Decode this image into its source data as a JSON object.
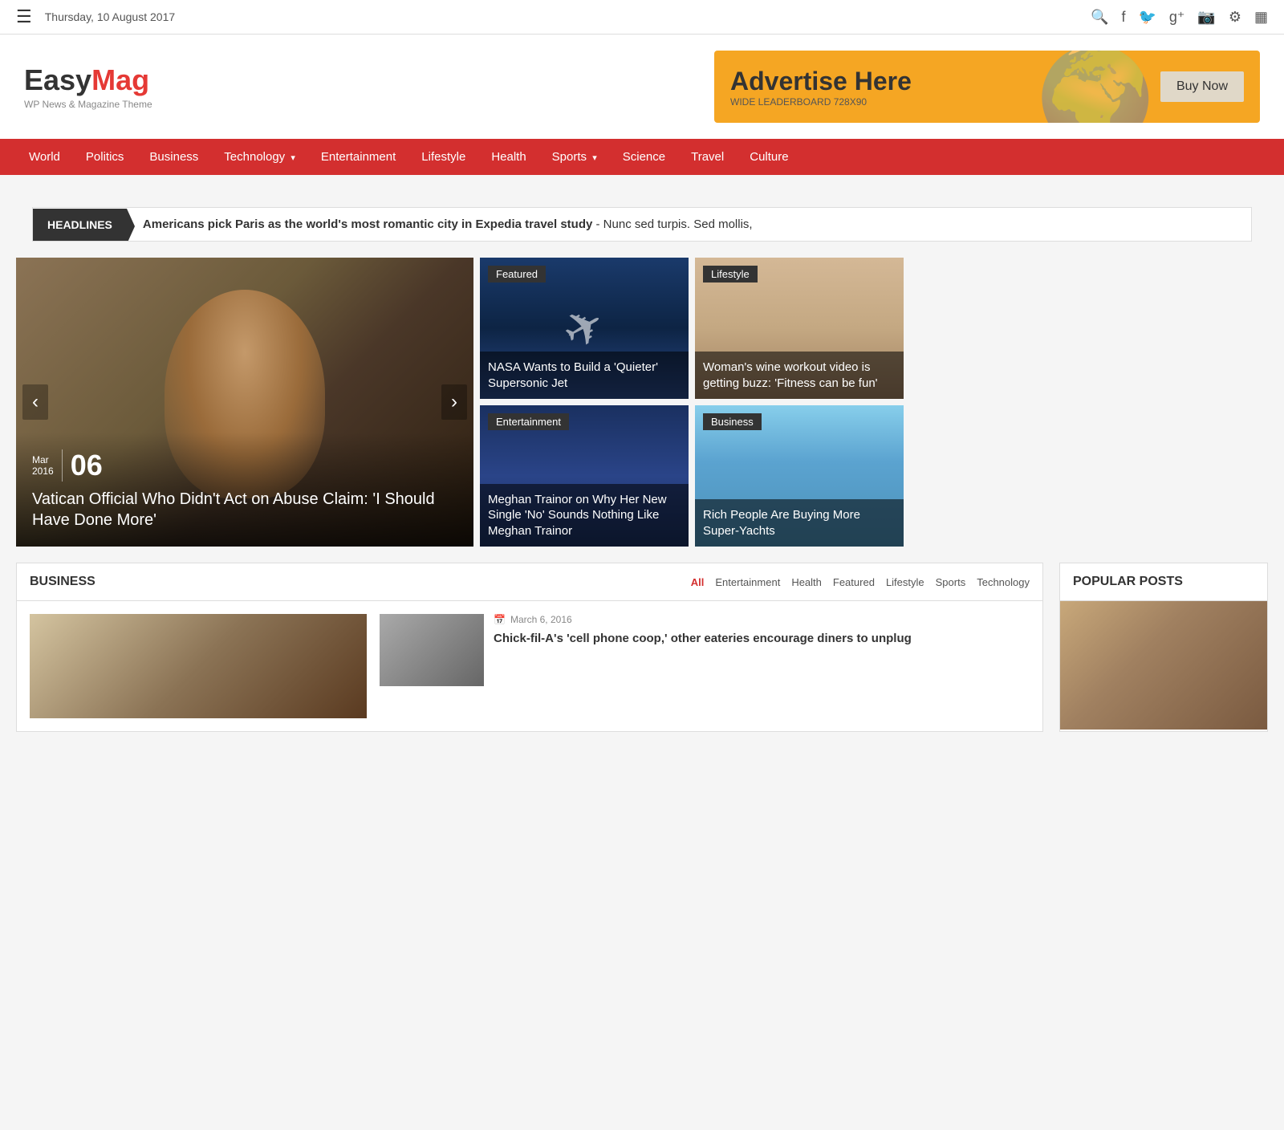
{
  "topbar": {
    "date": "Thursday, 10 August 2017",
    "icons": [
      "☰",
      "🔍",
      "f",
      "🐦",
      "g+",
      "📷",
      "⚙",
      "▦"
    ]
  },
  "header": {
    "logo_easy": "Easy",
    "logo_mag": "Mag",
    "logo_sub": "WP News & Magazine Theme",
    "ad_title": "Advertise Here",
    "ad_sub": "WIDE LEADERBOARD 728X90",
    "ad_btn": "Buy Now"
  },
  "nav": {
    "items": [
      {
        "label": "World",
        "hasDropdown": false
      },
      {
        "label": "Politics",
        "hasDropdown": false
      },
      {
        "label": "Business",
        "hasDropdown": false
      },
      {
        "label": "Technology",
        "hasDropdown": true
      },
      {
        "label": "Entertainment",
        "hasDropdown": false
      },
      {
        "label": "Lifestyle",
        "hasDropdown": false
      },
      {
        "label": "Health",
        "hasDropdown": false
      },
      {
        "label": "Sports",
        "hasDropdown": true
      },
      {
        "label": "Science",
        "hasDropdown": false
      },
      {
        "label": "Travel",
        "hasDropdown": false
      },
      {
        "label": "Culture",
        "hasDropdown": false
      }
    ]
  },
  "headlines": {
    "label": "HEADLINES",
    "bold": "Americans pick Paris as the world's most romantic city in Expedia travel study",
    "rest": " - Nunc sed turpis. Sed mollis,"
  },
  "featured_main": {
    "month": "Mar",
    "year": "2016",
    "day": "06",
    "title": "Vatican Official Who Didn't Act on Abuse Claim: 'I Should Have Done More'"
  },
  "featured_cards": [
    {
      "tag": "Featured",
      "title": "NASA Wants to Build a 'Quieter' Supersonic Jet",
      "bg_class": "card-nasa"
    },
    {
      "tag": "Lifestyle",
      "title": "Woman's wine workout video is getting buzz: 'Fitness can be fun'",
      "bg_class": "card-wine"
    },
    {
      "tag": "Entertainment",
      "title": "Meghan Trainor on Why Her New Single 'No' Sounds Nothing Like Meghan Trainor",
      "bg_class": "card-meghan"
    },
    {
      "tag": "Business",
      "title": "Rich People Are Buying More Super-Yachts",
      "bg_class": "card-yachts"
    }
  ],
  "business": {
    "section_title": "BUSINESS",
    "tabs": [
      "All",
      "Entertainment",
      "Health",
      "Featured",
      "Lifestyle",
      "Sports",
      "Technology"
    ],
    "article_date": "March 6, 2016",
    "article_title": "Chick-fil-A's 'cell phone coop,' other eateries encourage diners to unplug"
  },
  "popular": {
    "title": "POPULAR POSTS"
  }
}
